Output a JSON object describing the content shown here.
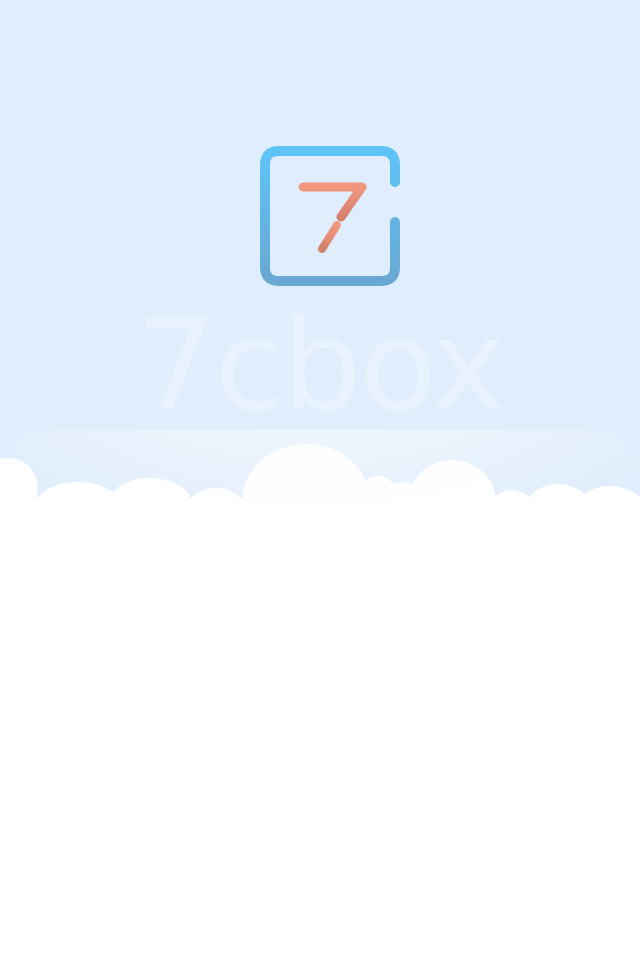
{
  "splash": {
    "app_name": "7cbox",
    "logo_icon": "7cbox-logo-icon",
    "logo_glyph": "7"
  },
  "colors": {
    "sky": "#dfedfc",
    "ground": "#ffffff",
    "logo_frame_top": "#5dc3f7",
    "logo_frame_bottom": "#6aa9d4",
    "logo_glyph_top": "#f1957e",
    "logo_glyph_bottom": "#d9826c"
  }
}
